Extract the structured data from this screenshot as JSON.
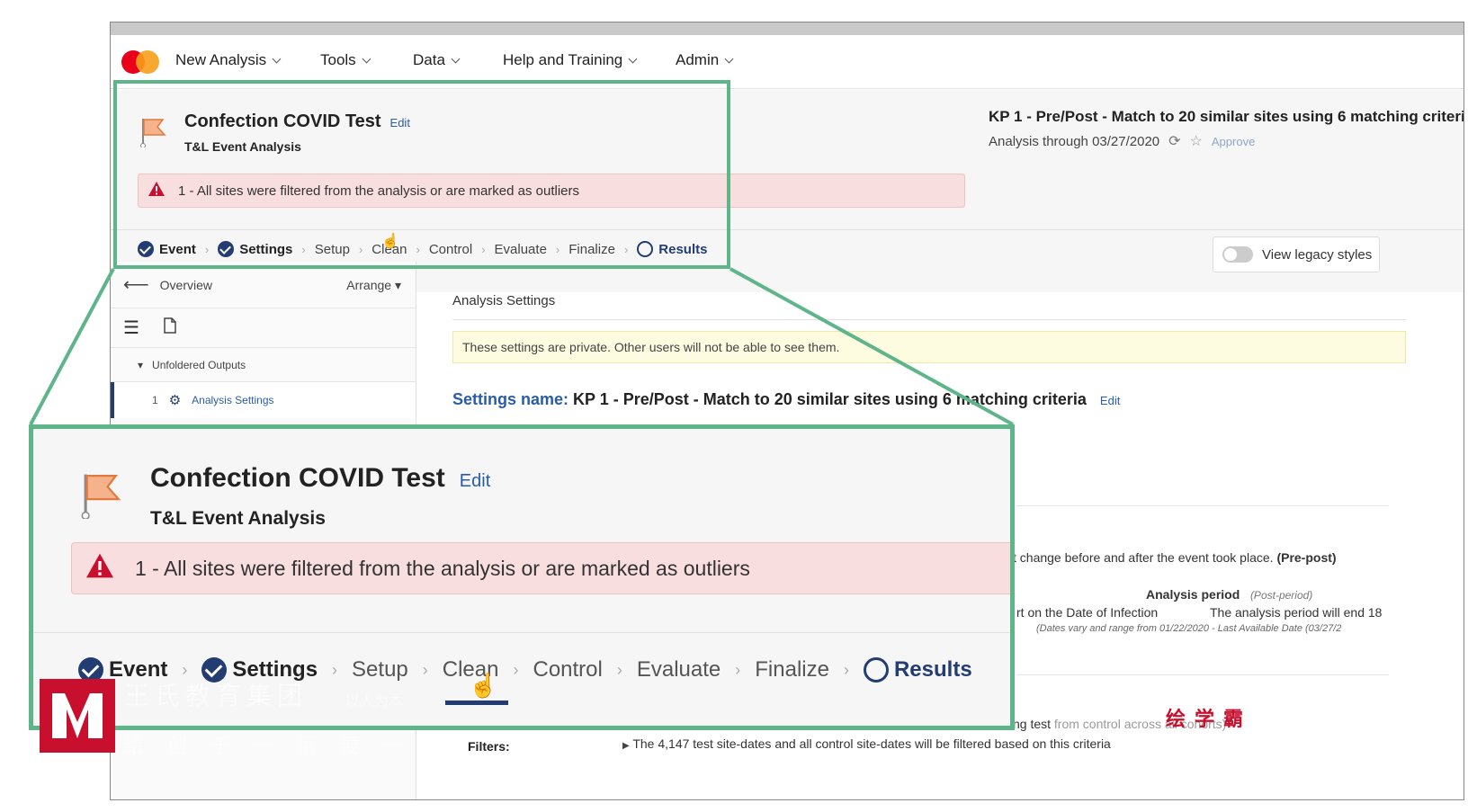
{
  "nav": {
    "items": [
      {
        "label": "New Analysis"
      },
      {
        "label": "Tools"
      },
      {
        "label": "Data"
      },
      {
        "label": "Help and Training"
      },
      {
        "label": "Admin"
      }
    ]
  },
  "header": {
    "title": "Confection COVID Test",
    "edit": "Edit",
    "subtitle": "T&L Event Analysis",
    "alert": "1 - All sites were filtered from the analysis or are marked as outliers",
    "kp_title": "KP 1 - Pre/Post - Match to 20 similar sites using 6 matching criteria",
    "kp_sub": "Analysis through 03/27/2020",
    "approve": "Approve"
  },
  "steps": [
    {
      "label": "Event",
      "state": "done"
    },
    {
      "label": "Settings",
      "state": "done"
    },
    {
      "label": "Setup",
      "state": "todo"
    },
    {
      "label": "Clean",
      "state": "active"
    },
    {
      "label": "Control",
      "state": "todo"
    },
    {
      "label": "Evaluate",
      "state": "todo"
    },
    {
      "label": "Finalize",
      "state": "todo"
    },
    {
      "label": "Results",
      "state": "result"
    }
  ],
  "legacy": {
    "label": "View legacy styles"
  },
  "sidebar": {
    "overview": "Overview",
    "arrange": "Arrange",
    "folder": "Unfoldered Outputs",
    "item_num": "1",
    "item_label": "Analysis Settings"
  },
  "main": {
    "title": "Analysis Settings",
    "note": "These settings are private. Other users will not be able to see them.",
    "settings_label": "Settings name:",
    "settings_value": "KP 1 - Pre/Post - Match to 20 similar sites using 6 matching criteria",
    "settings_edit": "Edit",
    "line1_a": "t change before and after the event took place.",
    "line1_b": "(Pre-post)",
    "period_label": "Analysis period",
    "period_sub": "(Post-period)",
    "line3": "rt on the Date of Infection",
    "line3b": "The analysis period will end 18",
    "line4": "(Dates vary and range from 01/22/2020 - Last Available Date (03/27/2",
    "line5_a": "ng test",
    "line5_b": "from control across all cohorts)",
    "filters_label": "Filters:",
    "filters_text": "The 4,147 test site-dates and all control site-dates will be filtered based on this criteria"
  },
  "watermark": {
    "line1": "王氏教育集团",
    "line1b": "以人为本",
    "line2": "给创于一家要一",
    "red": "绘学霸"
  },
  "colors": {
    "highlight": "#5fb58a",
    "navy": "#233c72",
    "link": "#2a5caa",
    "alert_bg": "#f8dede",
    "note_bg": "#fdfbe0"
  }
}
